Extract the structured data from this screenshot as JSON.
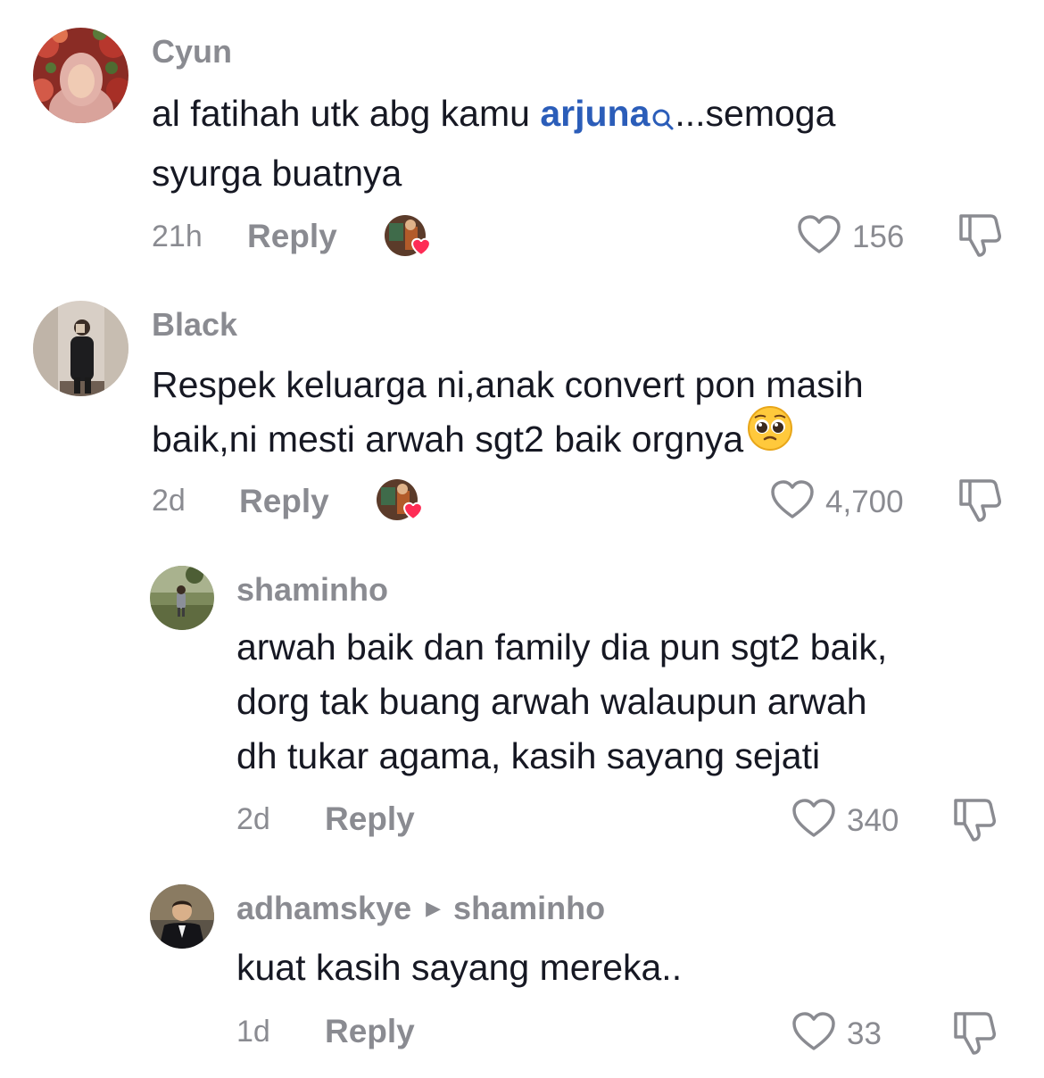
{
  "comments": [
    {
      "username": "Cyun",
      "text_before": "al fatihah utk abg kamu ",
      "mention": "arjuna",
      "text_after": "...semoga\nsyurga buatnya",
      "time": "21h",
      "reply_label": "Reply",
      "likes": "156"
    },
    {
      "username": "Black",
      "text": "Respek keluarga ni,anak convert pon masih\nbaik,ni mesti arwah sgt2 baik orgnya",
      "emoji": "pleading-face-icon",
      "time": "2d",
      "reply_label": "Reply",
      "likes": "4,700"
    },
    {
      "username": "shaminho",
      "text": "arwah baik dan family dia pun sgt2 baik,\ndorg tak buang arwah walaupun arwah\ndh tukar agama, kasih sayang sejati",
      "time": "2d",
      "reply_label": "Reply",
      "likes": "340"
    },
    {
      "username": "adhamskye",
      "reply_to": "shaminho",
      "text": "kuat kasih sayang mereka..",
      "time": "1d",
      "reply_label": "Reply",
      "likes": "33"
    }
  ],
  "colors": {
    "text": "#161823",
    "muted": "#8a8b91",
    "mention": "#2b5db9",
    "creator_heart": "#fe2c55"
  }
}
